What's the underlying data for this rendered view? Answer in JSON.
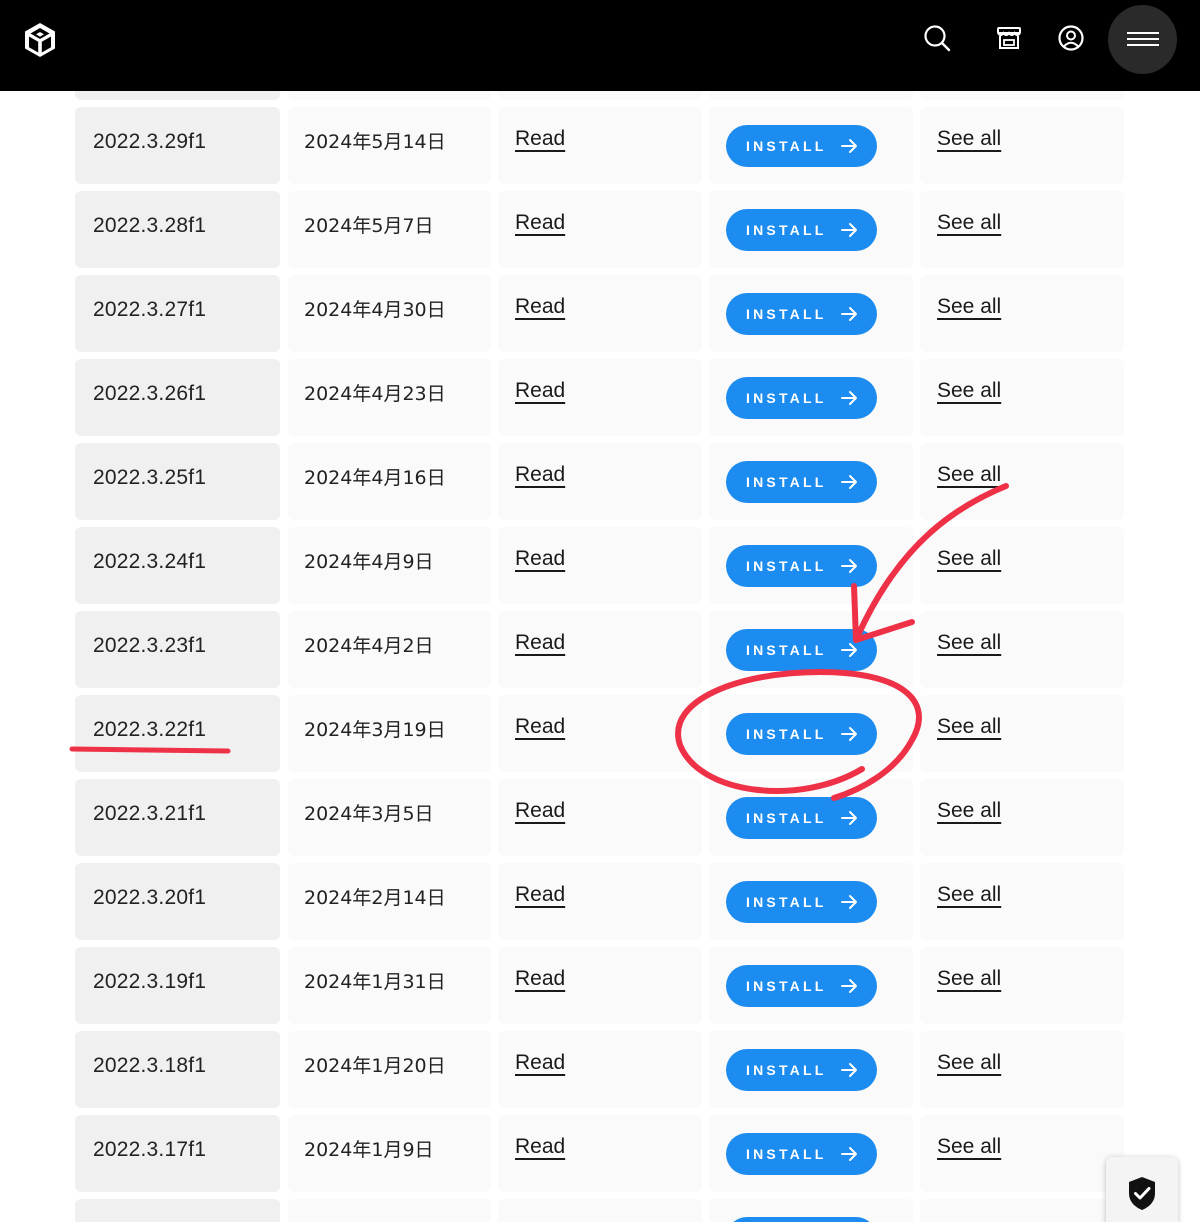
{
  "header": {
    "logo_icon": "unity-logo-icon",
    "icons": [
      "search-icon",
      "store-icon",
      "account-icon",
      "menu-icon"
    ]
  },
  "table": {
    "rows": [
      {
        "version": "2022.3.29f1",
        "date": "2024年5月14日",
        "notes": "Read",
        "install": "INSTALL",
        "modules": "See all"
      },
      {
        "version": "2022.3.28f1",
        "date": "2024年5月7日",
        "notes": "Read",
        "install": "INSTALL",
        "modules": "See all"
      },
      {
        "version": "2022.3.27f1",
        "date": "2024年4月30日",
        "notes": "Read",
        "install": "INSTALL",
        "modules": "See all"
      },
      {
        "version": "2022.3.26f1",
        "date": "2024年4月23日",
        "notes": "Read",
        "install": "INSTALL",
        "modules": "See all"
      },
      {
        "version": "2022.3.25f1",
        "date": "2024年4月16日",
        "notes": "Read",
        "install": "INSTALL",
        "modules": "See all"
      },
      {
        "version": "2022.3.24f1",
        "date": "2024年4月9日",
        "notes": "Read",
        "install": "INSTALL",
        "modules": "See all"
      },
      {
        "version": "2022.3.23f1",
        "date": "2024年4月2日",
        "notes": "Read",
        "install": "INSTALL",
        "modules": "See all"
      },
      {
        "version": "2022.3.22f1",
        "date": "2024年3月19日",
        "notes": "Read",
        "install": "INSTALL",
        "modules": "See all"
      },
      {
        "version": "2022.3.21f1",
        "date": "2024年3月5日",
        "notes": "Read",
        "install": "INSTALL",
        "modules": "See all"
      },
      {
        "version": "2022.3.20f1",
        "date": "2024年2月14日",
        "notes": "Read",
        "install": "INSTALL",
        "modules": "See all"
      },
      {
        "version": "2022.3.19f1",
        "date": "2024年1月31日",
        "notes": "Read",
        "install": "INSTALL",
        "modules": "See all"
      },
      {
        "version": "2022.3.18f1",
        "date": "2024年1月20日",
        "notes": "Read",
        "install": "INSTALL",
        "modules": "See all"
      },
      {
        "version": "2022.3.17f1",
        "date": "2024年1月9日",
        "notes": "Read",
        "install": "INSTALL",
        "modules": "See all"
      }
    ]
  },
  "highlighted_row": 7,
  "colors": {
    "header_bg": "#000000",
    "install_button": "#1d8cf0",
    "annotation": "#ee3146",
    "cell_bg": "#f6f6f6"
  },
  "floating": {
    "icon": "shield-check-icon"
  }
}
